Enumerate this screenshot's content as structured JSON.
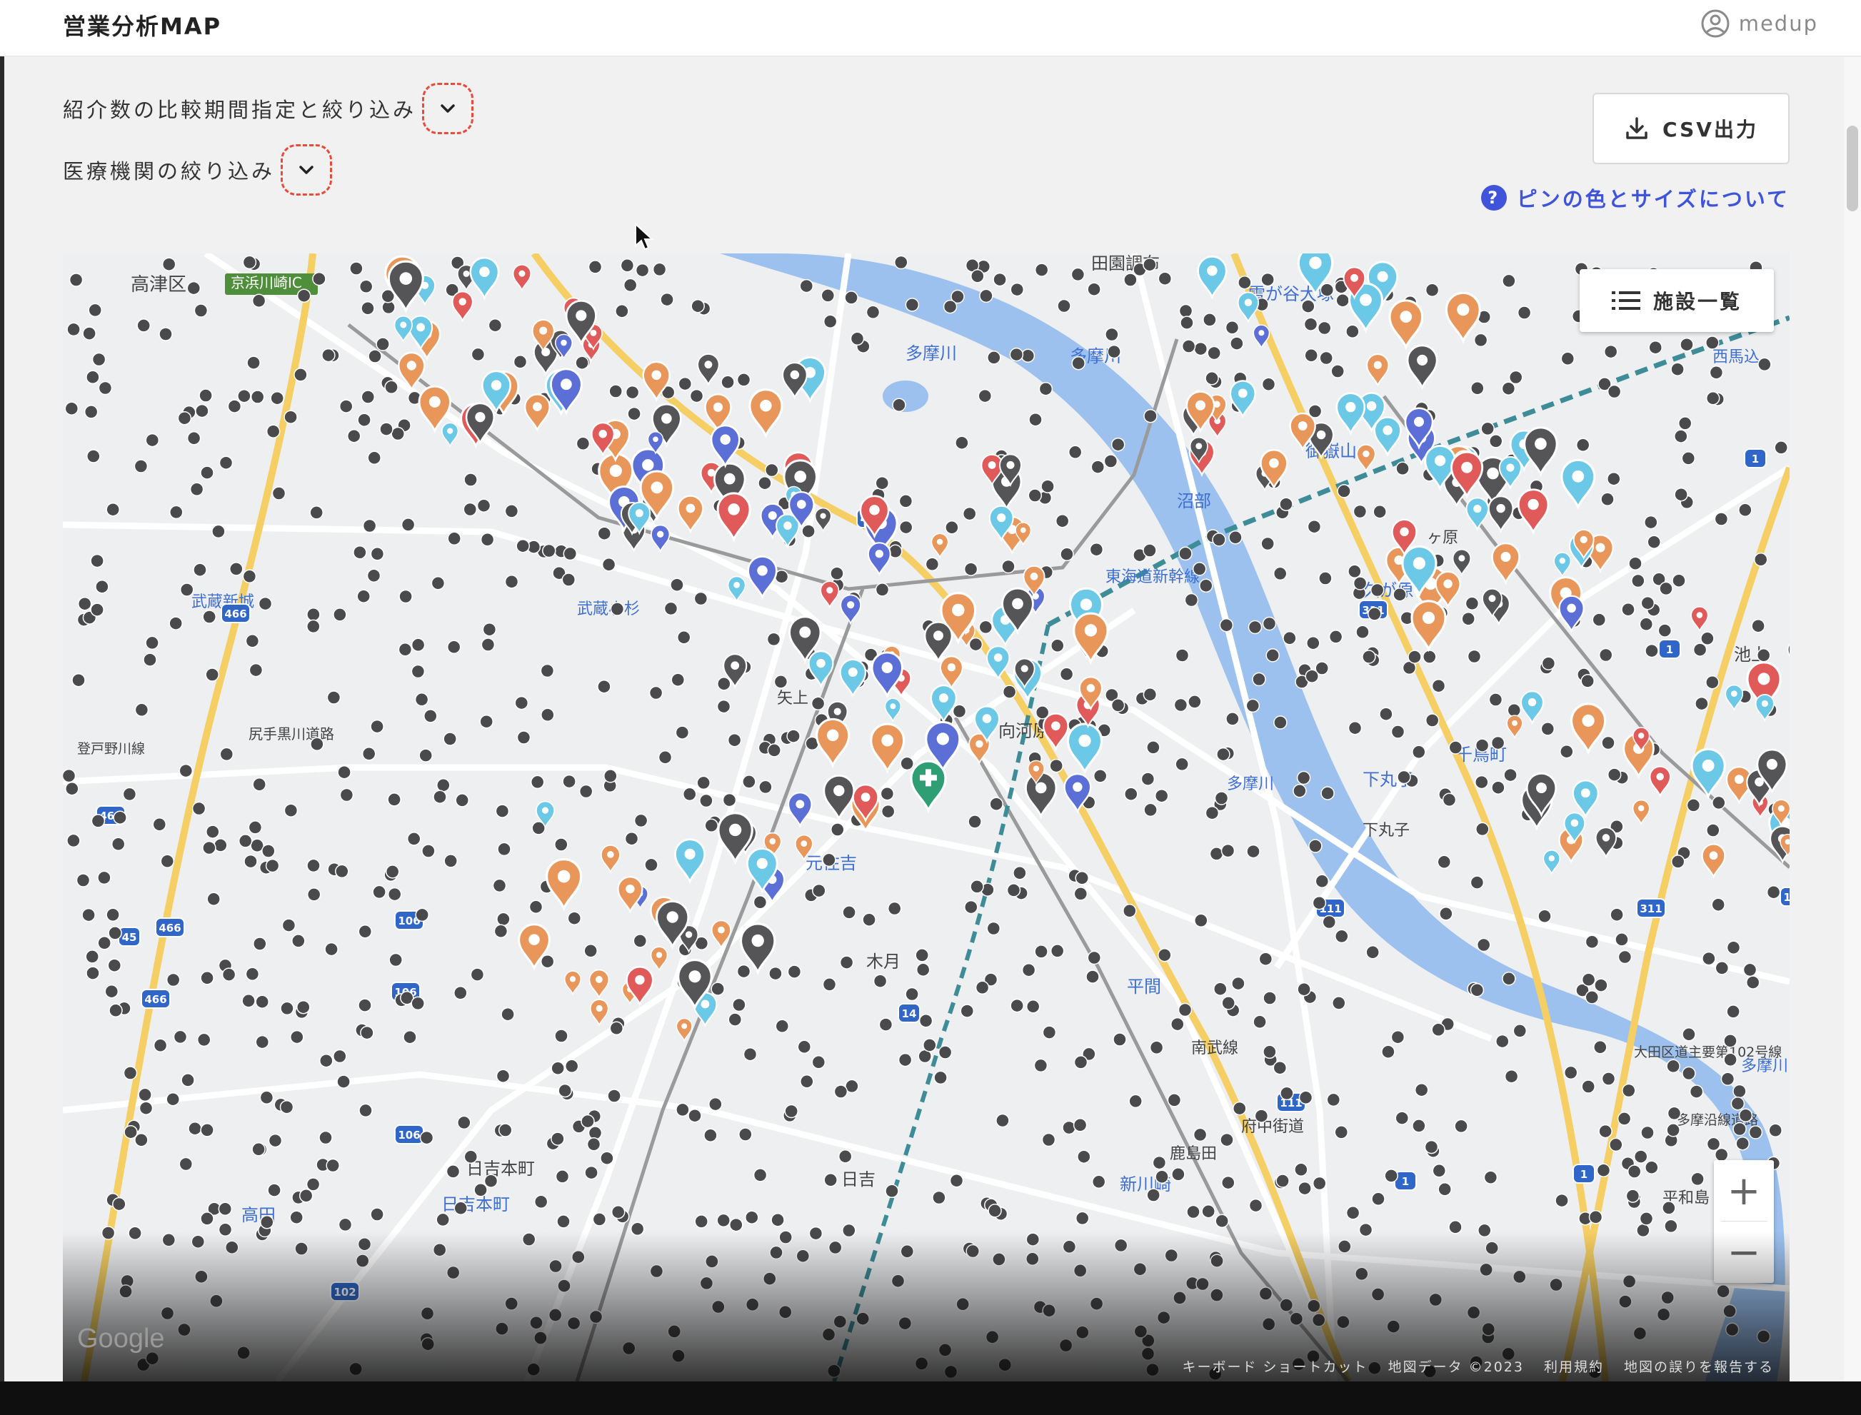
{
  "header": {
    "title": "営業分析MAP",
    "user_name": "medup"
  },
  "filters": {
    "comparison_label": "紹介数の比較期間指定と絞り込み",
    "facility_label": "医療機関の絞り込み"
  },
  "actions": {
    "csv_label": "CSV出力",
    "help_label": "ピンの色とサイズについて"
  },
  "map": {
    "facility_list_label": "施設一覧",
    "zoom_in": "+",
    "zoom_out": "−",
    "google_label": "Google",
    "attribution": {
      "shortcuts": "キーボード ショートカット",
      "data": "地図データ ©2023",
      "terms": "利用規約",
      "report": "地図の誤りを報告する"
    },
    "place_labels": [
      "高津区",
      "京浜川崎IC",
      "田園調布",
      "雪が谷大塚",
      "多摩川",
      "多摩川",
      "御嶽山",
      "沼部",
      "東海道新幹線",
      "久が原",
      "西馬込",
      "ヶ原",
      "千鳥町",
      "下丸子",
      "下丸子",
      "武蔵新城",
      "武蔵小杉",
      "元住吉",
      "平間",
      "木月",
      "日吉本町",
      "日吉",
      "日吉本町",
      "高田",
      "新川崎",
      "鹿島田",
      "府中街道",
      "南武線",
      "多摩川",
      "大田区道主要第102号線",
      "多摩川",
      "多摩沿線道路",
      "矢上",
      "尻手黒川道路",
      "登戸野川線",
      "向河原",
      "池上",
      "平和島"
    ],
    "route_shields": [
      "466",
      "466",
      "466",
      "466",
      "45",
      "45",
      "106",
      "106",
      "106",
      "14",
      "102",
      "111",
      "111",
      "111",
      "311",
      "311",
      "1",
      "1",
      "1",
      "1"
    ],
    "pin_colors": {
      "gray": "#555558",
      "cyan": "#6bc8e6",
      "orange": "#e9965a",
      "red": "#e05a5a",
      "blue": "#5b6fd6",
      "green": "#2f9e74"
    }
  }
}
